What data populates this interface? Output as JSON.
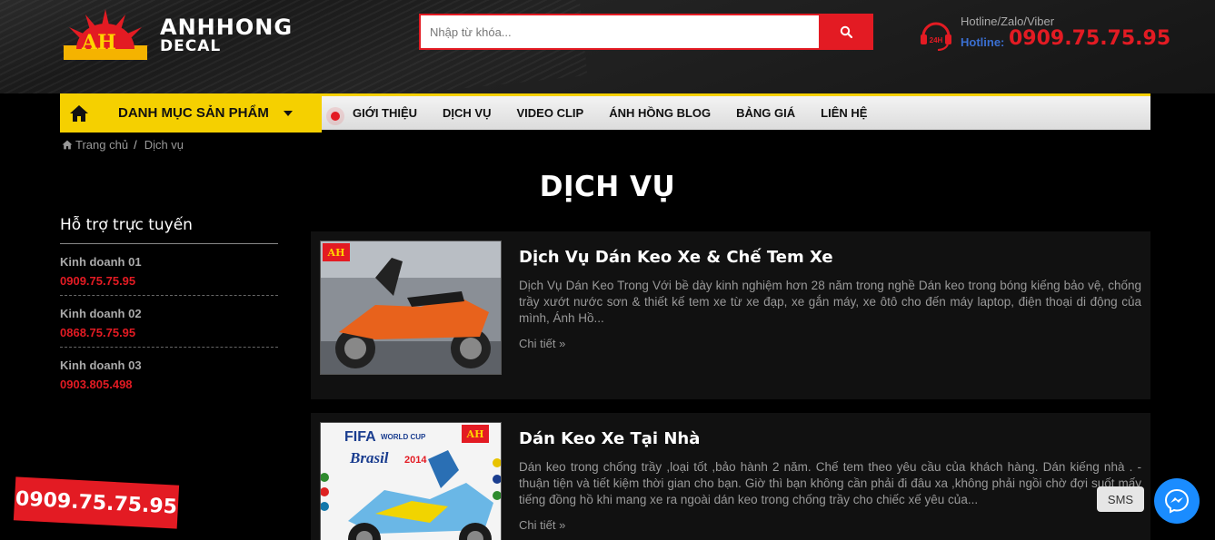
{
  "header": {
    "logo": {
      "badge_text": "AH",
      "line1": "ANHHONG",
      "line2": "DECAL"
    },
    "search": {
      "placeholder": "Nhập từ khóa..."
    },
    "hotline": {
      "top_text": "Hotline/Zalo/Viber",
      "label": "Hotline:",
      "number": "0909.75.75.95",
      "icon_text": "24H"
    }
  },
  "nav": {
    "category_label": "DANH MỤC SẢN PHẨM",
    "items": [
      "GIỚI THIỆU",
      "DỊCH VỤ",
      "VIDEO CLIP",
      "ÁNH HỒNG BLOG",
      "BẢNG GIÁ",
      "LIÊN HỆ"
    ]
  },
  "breadcrumb": {
    "home": "Trang chủ",
    "separator": "/",
    "current": "Dịch vụ"
  },
  "page_title": "DỊCH VỤ",
  "sidebar": {
    "title": "Hỗ trợ trực tuyến",
    "contacts": [
      {
        "name": "Kinh doanh 01",
        "phone": "0909.75.75.95"
      },
      {
        "name": "Kinh doanh 02",
        "phone": "0868.75.75.95"
      },
      {
        "name": "Kinh doanh 03",
        "phone": "0903.805.498"
      }
    ]
  },
  "posts": [
    {
      "title": "Dịch Vụ Dán Keo Xe & Chế Tem Xe",
      "excerpt": "Dịch Vụ Dán Keo Trong Với bề dày kinh nghiệm hơn 28 năm trong nghề Dán keo trong bóng kiếng bảo vệ, chống trầy xướt nước sơn & thiết kế tem xe từ xe đạp, xe gắn máy, xe ôtô cho đến máy laptop, điện thoại di động của mình, Ánh Hồ...",
      "more": "Chi tiết »",
      "thumb_badge": "AH"
    },
    {
      "title": "Dán Keo Xe Tại Nhà",
      "excerpt": "Dán keo trong chống trầy ,loại tốt ,bảo hành 2 năm. Chế tem theo yêu cầu của khách hàng. Dán kiếng nhà . -thuận tiện và tiết kiệm thời gian cho bạn. Giờ thì bạn không cần phải đi đâu xa ,không phải ngồi chờ đợi suốt mấy tiếng đồng hồ khi mang xe ra ngoài dán keo trong chống trầy cho chiếc xế yêu của...",
      "more": "Chi tiết »",
      "thumb_caption1": "FIFA",
      "thumb_caption2": "WORLD CUP",
      "thumb_caption3": "Brasil",
      "thumb_caption4": "2014",
      "thumb_badge": "AH"
    }
  ],
  "floating": {
    "phone": "0909.75.75.95",
    "sms": "SMS"
  },
  "colors": {
    "accent_red": "#e31b23",
    "nav_yellow": "#f5d000",
    "messenger_blue": "#1a8cff"
  }
}
